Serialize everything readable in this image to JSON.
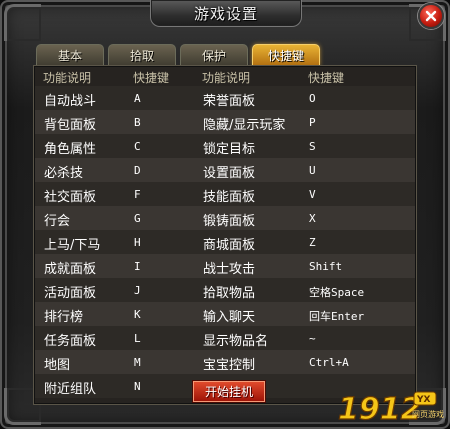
{
  "window": {
    "title": "游戏设置",
    "close_icon": "close-icon"
  },
  "tabs": [
    {
      "label": "基本",
      "active": false
    },
    {
      "label": "拾取",
      "active": false
    },
    {
      "label": "保护",
      "active": false
    },
    {
      "label": "快捷键",
      "active": true
    }
  ],
  "columns": {
    "func_left": "功能说明",
    "key_left": "快捷键",
    "func_right": "功能说明",
    "key_right": "快捷键"
  },
  "rows": [
    {
      "func_left": "自动战斗",
      "key_left": "A",
      "func_right": "荣誉面板",
      "key_right": "O"
    },
    {
      "func_left": "背包面板",
      "key_left": "B",
      "func_right": "隐藏/显示玩家",
      "key_right": "P"
    },
    {
      "func_left": "角色属性",
      "key_left": "C",
      "func_right": "锁定目标",
      "key_right": "S"
    },
    {
      "func_left": "必杀技",
      "key_left": "D",
      "func_right": "设置面板",
      "key_right": "U"
    },
    {
      "func_left": "社交面板",
      "key_left": "F",
      "func_right": "技能面板",
      "key_right": "V"
    },
    {
      "func_left": "行会",
      "key_left": "G",
      "func_right": "锻铸面板",
      "key_right": "X"
    },
    {
      "func_left": "上马/下马",
      "key_left": "H",
      "func_right": "商城面板",
      "key_right": "Z"
    },
    {
      "func_left": "成就面板",
      "key_left": "I",
      "func_right": "战士攻击",
      "key_right": "Shift"
    },
    {
      "func_left": "活动面板",
      "key_left": "J",
      "func_right": "拾取物品",
      "key_right": "空格Space"
    },
    {
      "func_left": "排行榜",
      "key_left": "K",
      "func_right": "输入聊天",
      "key_right": "回车Enter"
    },
    {
      "func_left": "任务面板",
      "key_left": "L",
      "func_right": "显示物品名",
      "key_right": "~"
    },
    {
      "func_left": "地图",
      "key_left": "M",
      "func_right": "宝宝控制",
      "key_right": "Ctrl+A"
    },
    {
      "func_left": "附近组队",
      "key_left": "N",
      "func_right": "",
      "key_right": ""
    }
  ],
  "start_button": {
    "label": "开始挂机"
  },
  "watermark": {
    "text": "1912",
    "badge": "YX",
    "subtext": "网页游戏"
  },
  "colors": {
    "active_tab": "#e9b334",
    "start_button": "#c42a14",
    "close_button": "#c41c10"
  }
}
